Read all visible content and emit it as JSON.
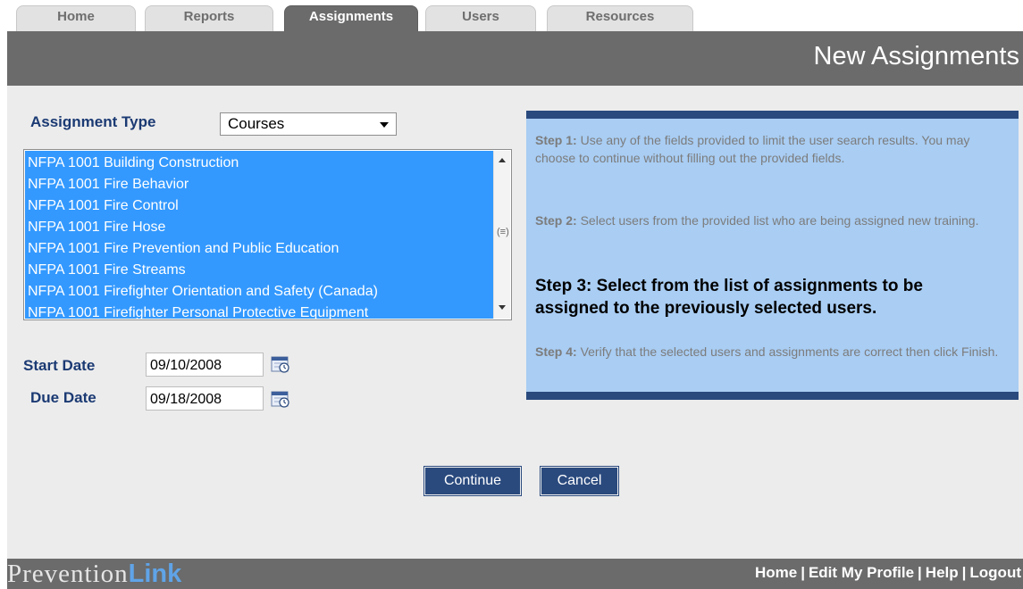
{
  "tabs": [
    {
      "label": "Home",
      "active": false
    },
    {
      "label": "Reports",
      "active": false
    },
    {
      "label": "Assignments",
      "active": true
    },
    {
      "label": "Users",
      "active": false
    },
    {
      "label": "Resources",
      "active": false
    }
  ],
  "header": {
    "title": "New Assignments"
  },
  "form": {
    "assignment_type_label": "Assignment Type",
    "assignment_type_value": "Courses",
    "course_list": [
      "NFPA 1001 Building Construction",
      "NFPA 1001 Fire Behavior",
      "NFPA 1001 Fire Control",
      "NFPA 1001 Fire Hose",
      "NFPA 1001 Fire Prevention and Public Education",
      "NFPA 1001 Fire Streams",
      "NFPA 1001 Firefighter Orientation and Safety (Canada)",
      "NFPA 1001 Firefighter Personal Protective Equipment"
    ],
    "start_date_label": "Start Date",
    "start_date_value": "09/10/2008",
    "due_date_label": "Due Date",
    "due_date_value": "09/18/2008"
  },
  "steps": {
    "step1_heading": "Step 1:",
    "step1_text": "Use any of the fields provided to limit the user search results. You may choose to continue without filling out the provided fields.",
    "step2_heading": "Step 2:",
    "step2_text": "Select users from the provided list who are being assigned new training.",
    "step3_text": "Step 3: Select from the list of assignments to be assigned to the previously selected users.",
    "step4_heading": "Step 4:",
    "step4_text": "Verify that the selected users and assignments are correct then click Finish."
  },
  "buttons": {
    "continue_label": "Continue",
    "cancel_label": "Cancel"
  },
  "footer": {
    "logo_part1": "Prevention",
    "logo_part2": "Link",
    "links": [
      "Home",
      "Edit My Profile",
      "Help",
      "Logout"
    ],
    "separator": "|"
  },
  "colors": {
    "header_gray": "#6b6b6b",
    "panel_blue": "#a9cdf3",
    "navy": "#2a4a7e",
    "selection_blue": "#3399ff",
    "label_navy": "#1b3a73"
  }
}
